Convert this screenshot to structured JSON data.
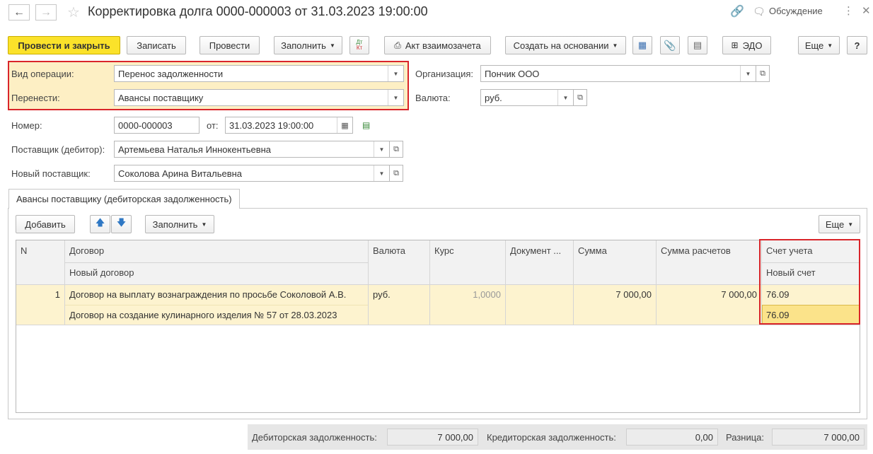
{
  "window": {
    "title": "Корректировка долга 0000-000003 от 31.03.2023 19:00:00",
    "discussion_label": "Обсуждение"
  },
  "toolbar": {
    "post_close": "Провести и закрыть",
    "save": "Записать",
    "post": "Провести",
    "fill": "Заполнить",
    "dt_kt_top": "Дт",
    "dt_kt_bottom": "Кт",
    "act": "Акт взаимозачета",
    "create_based": "Создать на основании",
    "edo": "ЭДО",
    "more": "Еще",
    "help": "?"
  },
  "form": {
    "operation_label": "Вид операции:",
    "operation_value": "Перенос задолженности",
    "transfer_label": "Перенести:",
    "transfer_value": "Авансы поставщику",
    "org_label": "Организация:",
    "org_value": "Пончик ООО",
    "currency_label": "Валюта:",
    "currency_value": "руб.",
    "number_label": "Номер:",
    "number_value": "0000-000003",
    "date_label": "от:",
    "date_value": "31.03.2023 19:00:00",
    "supplier_label": "Поставщик (дебитор):",
    "supplier_value": "Артемьева Наталья Иннокентьевна",
    "new_supplier_label": "Новый поставщик:",
    "new_supplier_value": "Соколова Арина Витальевна"
  },
  "tab": {
    "label": "Авансы поставщику (дебиторская задолженность)"
  },
  "table_toolbar": {
    "add": "Добавить",
    "fill": "Заполнить",
    "more": "Еще"
  },
  "table": {
    "headers": {
      "n": "N",
      "contract": "Договор",
      "new_contract": "Новый договор",
      "currency": "Валюта",
      "rate": "Курс",
      "document": "Документ ...",
      "sum": "Сумма",
      "sum_settle": "Сумма расчетов",
      "account": "Счет учета",
      "new_account": "Новый счет"
    },
    "rows": [
      {
        "n": "1",
        "contract": "Договор на выплату вознаграждения по просьбе Соколовой А.В.",
        "new_contract": "Договор на создание кулинарного изделия № 57 от 28.03.2023",
        "currency": "руб.",
        "rate": "1,0000",
        "document": "",
        "sum": "7 000,00",
        "sum_settle": "7 000,00",
        "account": "76.09",
        "new_account": "76.09"
      }
    ]
  },
  "footer": {
    "debit_label": "Дебиторская задолженность:",
    "debit_value": "7 000,00",
    "credit_label": "Кредиторская задолженность:",
    "credit_value": "0,00",
    "diff_label": "Разница:",
    "diff_value": "7 000,00"
  }
}
